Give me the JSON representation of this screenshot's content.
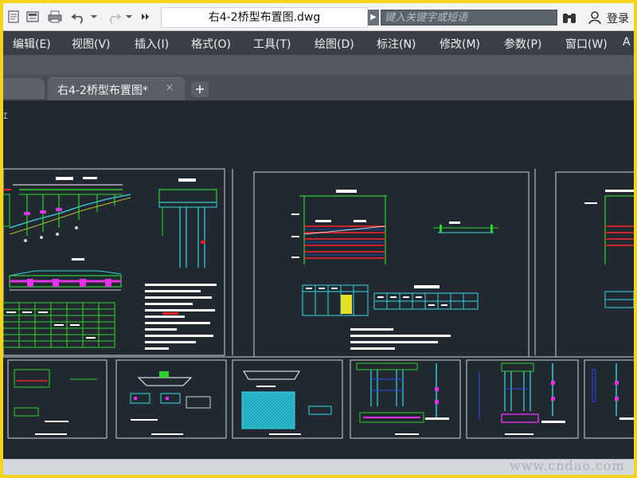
{
  "document": {
    "title": "右4-2桥型布置图.dwg"
  },
  "quick_access": {
    "icons": [
      "new-icon",
      "open-icon",
      "print-icon",
      "undo-icon",
      "redo-icon",
      "more-icon"
    ]
  },
  "search": {
    "placeholder": "键入关键字或短语"
  },
  "account": {
    "login_label": "登录"
  },
  "menu": {
    "items": [
      "编辑(E)",
      "视图(V)",
      "插入(I)",
      "格式(O)",
      "工具(T)",
      "绘图(D)",
      "标注(N)",
      "修改(M)",
      "参数(P)",
      "窗口(W)",
      "A"
    ]
  },
  "tabs": {
    "active_label": "右4-2桥型布置图*",
    "close_glyph": "×",
    "add_glyph": "+"
  },
  "viewport": {
    "label": "ｴ"
  },
  "watermark": {
    "text": "www.cndao.com"
  },
  "colors": {
    "frame": "#f4d21e",
    "canvas_bg": "#212830",
    "menu_bg": "#3a3f46",
    "drawing_white": "#ffffff",
    "drawing_green": "#2fd12f",
    "drawing_cyan": "#37d6e6",
    "drawing_magenta": "#e033e6",
    "drawing_red": "#e0262a",
    "drawing_yellow": "#e6e02a",
    "drawing_blue": "#2c4cf0"
  }
}
